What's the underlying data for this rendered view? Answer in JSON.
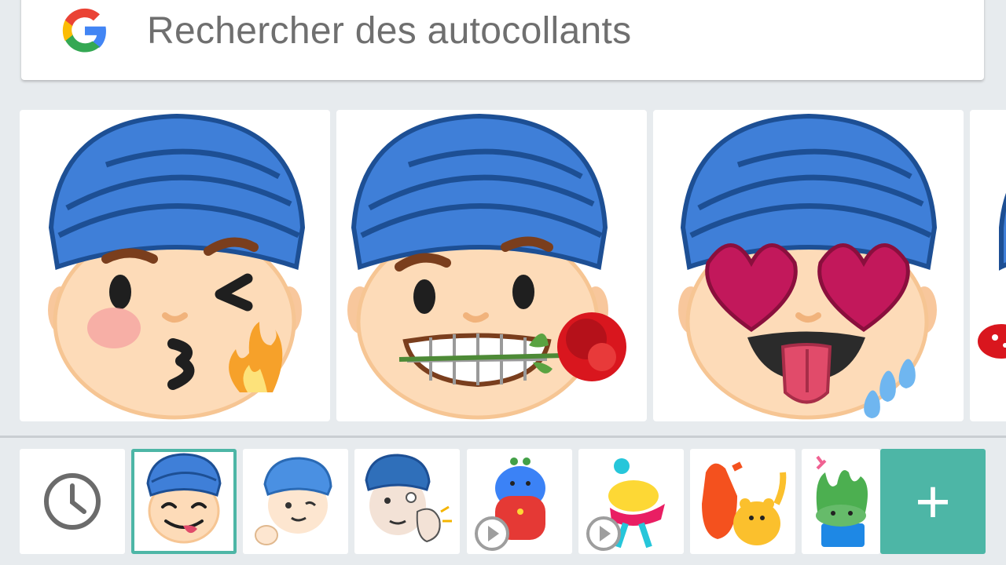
{
  "search": {
    "placeholder": "Rechercher des autocollants",
    "logo_icon": "google-g-icon"
  },
  "stickers": [
    {
      "name": "kiss-wink-fire-sticker"
    },
    {
      "name": "rose-grin-sticker"
    },
    {
      "name": "heart-eyes-tongue-sticker"
    },
    {
      "name": "partial-lips-sticker"
    }
  ],
  "tray": {
    "items": [
      {
        "name": "recent-clock-icon"
      },
      {
        "name": "pack-turban-emoji",
        "selected": true
      },
      {
        "name": "pack-turban-wink"
      },
      {
        "name": "pack-turban-ok"
      },
      {
        "name": "pack-blue-monster-animated"
      },
      {
        "name": "pack-dancer-animated"
      },
      {
        "name": "pack-bears"
      },
      {
        "name": "pack-plant"
      }
    ],
    "add_label": "+"
  },
  "colors": {
    "background": "#e7ebee",
    "accent": "#4db6a6",
    "turban": "#3f7fd8",
    "skin": "#fddbb8"
  }
}
